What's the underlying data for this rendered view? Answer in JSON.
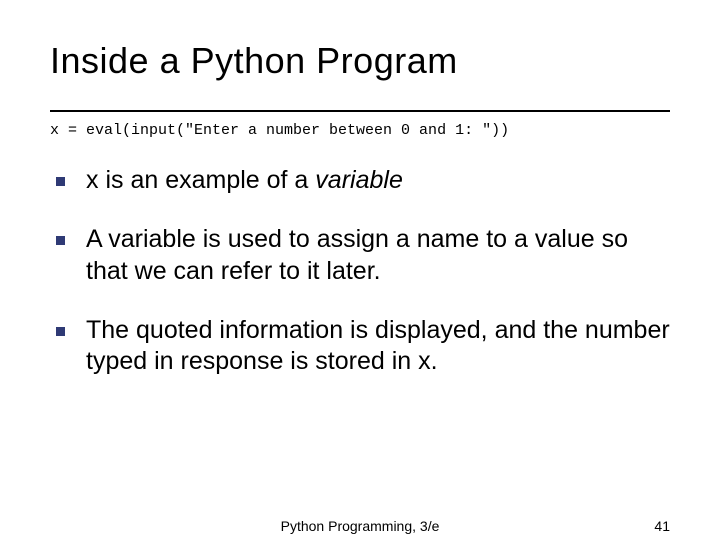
{
  "title": "Inside a Python Program",
  "code": "x = eval(input(\"Enter a number between 0 and 1: \"))",
  "bullets": [
    {
      "pre": "x is an example of a ",
      "em": "variable",
      "post": ""
    },
    {
      "pre": "A variable is used to assign a name to a value so that we can refer to it later.",
      "em": "",
      "post": ""
    },
    {
      "pre": "The quoted information is displayed, and the number typed in response is stored in x.",
      "em": "",
      "post": ""
    }
  ],
  "footer": {
    "center": "Python Programming, 3/e",
    "page": "41"
  }
}
